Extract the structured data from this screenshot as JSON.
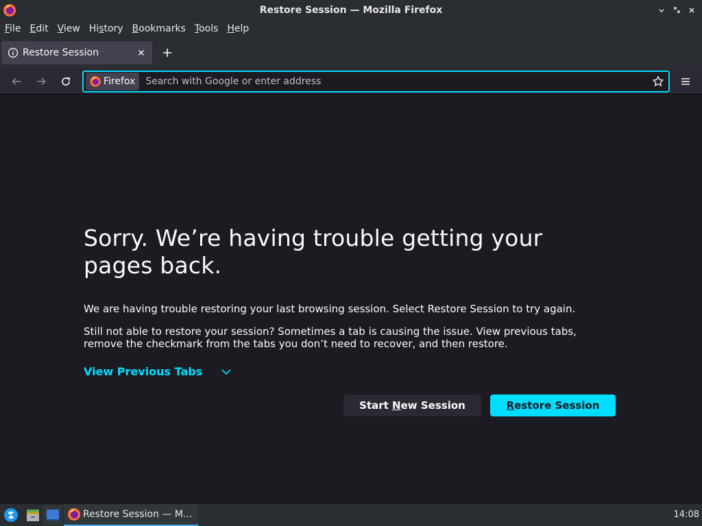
{
  "window": {
    "title": "Restore Session — Mozilla Firefox"
  },
  "menubar": {
    "items": [
      {
        "label": "File",
        "mnemonic": "F",
        "rest": "ile"
      },
      {
        "label": "Edit",
        "mnemonic": "E",
        "rest": "dit"
      },
      {
        "label": "View",
        "mnemonic": "V",
        "rest": "iew"
      },
      {
        "label": "History",
        "pre": "Hi",
        "mnemonic": "s",
        "rest": "tory"
      },
      {
        "label": "Bookmarks",
        "mnemonic": "B",
        "rest": "ookmarks"
      },
      {
        "label": "Tools",
        "mnemonic": "T",
        "rest": "ools"
      },
      {
        "label": "Help",
        "mnemonic": "H",
        "rest": "elp"
      }
    ]
  },
  "tabs": {
    "active": {
      "title": "Restore Session"
    }
  },
  "urlbar": {
    "identity_label": "Firefox",
    "placeholder": "Search with Google or enter address",
    "value": ""
  },
  "page": {
    "heading": "Sorry. We’re having trouble getting your pages back.",
    "description1": "We are having trouble restoring your last browsing session. Select Restore Session to try again.",
    "description2": "Still not able to restore your session? Sometimes a tab is causing the issue. View previous tabs, remove the checkmark from the tabs you don’t need to recover, and then restore.",
    "view_previous_tabs": "View Previous Tabs",
    "start_new_session": {
      "pre": "Start ",
      "mnemonic": "N",
      "rest": "ew Session"
    },
    "restore_session": {
      "pre": "",
      "mnemonic": "R",
      "rest": "estore Session"
    }
  },
  "taskbar": {
    "task_label": "Restore Session — M...",
    "clock": "14:08"
  },
  "colors": {
    "accent": "#00ddff",
    "background": "#1c1b22",
    "chrome": "#2a2e32"
  },
  "icons": [
    "firefox-logo-icon",
    "minimize-icon",
    "restore-icon",
    "close-icon",
    "info-icon",
    "tab-close-icon",
    "new-tab-icon",
    "back-icon",
    "forward-icon",
    "reload-icon",
    "firefox-identity-icon",
    "bookmark-star-icon",
    "hamburger-menu-icon",
    "chevron-down-icon",
    "app-launcher-icon",
    "file-manager-icon",
    "desktop-icon"
  ]
}
